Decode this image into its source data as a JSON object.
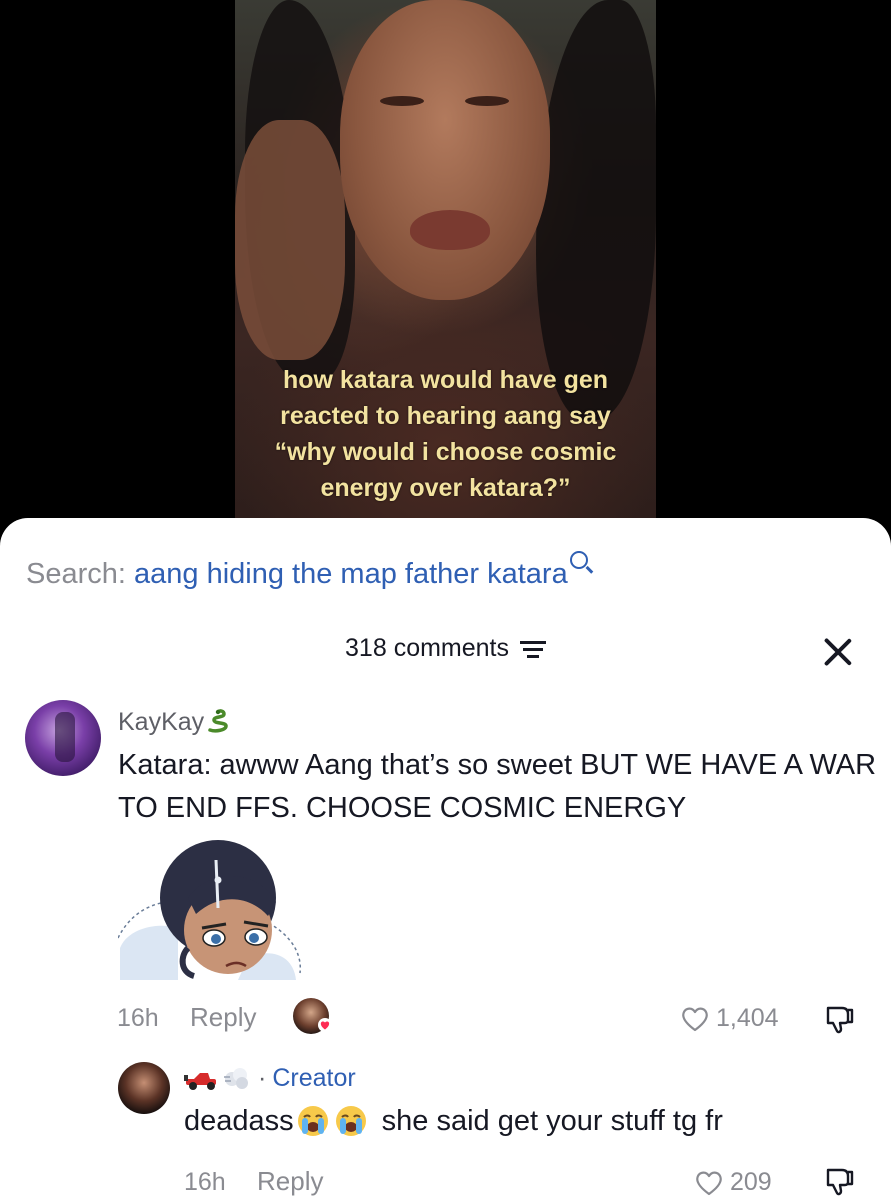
{
  "video": {
    "caption_lines": [
      "how katara would have gen",
      "reacted to hearing aang say",
      "“why would i choose cosmic",
      "energy over katara?”"
    ]
  },
  "search": {
    "prefix": "Search:",
    "query": "aang hiding the map father katara"
  },
  "comments_header": {
    "count_label": "318 comments"
  },
  "comments": [
    {
      "username": "KayKay",
      "text": "Katara: awww Aang that’s so sweet BUT WE HAVE A WAR TO END FFS. CHOOSE COSMIC ENERGY",
      "time": "16h",
      "reply_label": "Reply",
      "likes": "1,404",
      "creator_liked": true
    },
    {
      "label": "Creator",
      "text_before": "deadass",
      "text_after": "she said get your stuff tg fr",
      "time": "16h",
      "reply_label": "Reply",
      "likes": "209"
    }
  ],
  "colors": {
    "link_blue": "#2f5fb3",
    "caption_yellow": "#f3e3a0",
    "muted_gray": "#8a8b91"
  }
}
